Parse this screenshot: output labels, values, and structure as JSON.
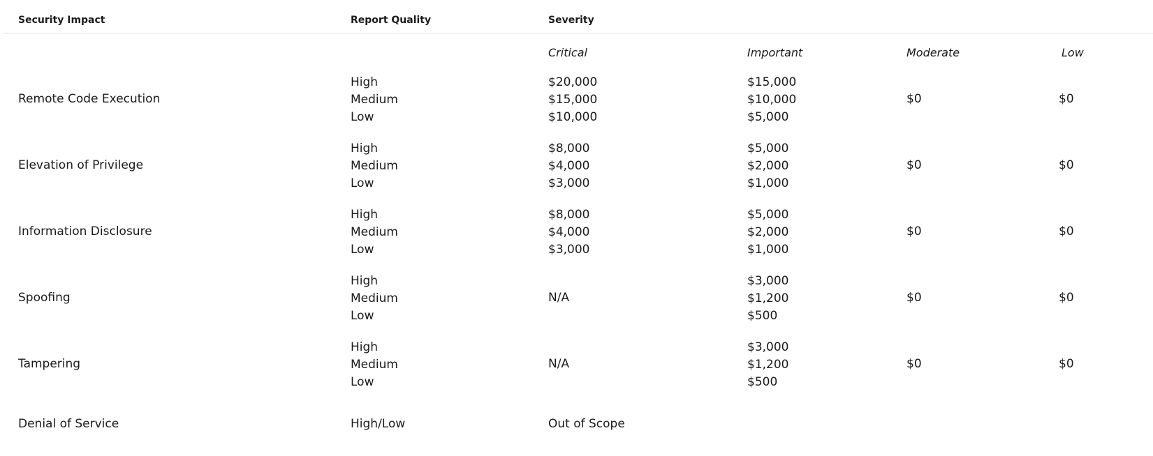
{
  "headers": {
    "security_impact": "Security Impact",
    "report_quality": "Report Quality",
    "severity": "Severity"
  },
  "severity_levels": {
    "critical": "Critical",
    "important": "Important",
    "moderate": "Moderate",
    "low": "Low"
  },
  "rows": [
    {
      "impact": "Remote Code Execution",
      "quality": [
        "High",
        "Medium",
        "Low"
      ],
      "critical": [
        "$20,000",
        "$15,000",
        "$10,000"
      ],
      "important": [
        "$15,000",
        "$10,000",
        "$5,000"
      ],
      "moderate": "$0",
      "low": "$0"
    },
    {
      "impact": "Elevation of Privilege",
      "quality": [
        "High",
        "Medium",
        "Low"
      ],
      "critical": [
        "$8,000",
        "$4,000",
        "$3,000"
      ],
      "important": [
        "$5,000",
        "$2,000",
        "$1,000"
      ],
      "moderate": "$0",
      "low": "$0"
    },
    {
      "impact": "Information Disclosure",
      "quality": [
        "High",
        "Medium",
        "Low"
      ],
      "critical": [
        "$8,000",
        "$4,000",
        "$3,000"
      ],
      "important": [
        "$5,000",
        "$2,000",
        "$1,000"
      ],
      "moderate": "$0",
      "low": "$0"
    },
    {
      "impact": "Spoofing",
      "quality": [
        "High",
        "Medium",
        "Low"
      ],
      "critical": "N/A",
      "important": [
        "$3,000",
        "$1,200",
        "$500"
      ],
      "moderate": "$0",
      "low": "$0"
    },
    {
      "impact": "Tampering",
      "quality": [
        "High",
        "Medium",
        "Low"
      ],
      "critical": "N/A",
      "important": [
        "$3,000",
        "$1,200",
        "$500"
      ],
      "moderate": "$0",
      "low": "$0"
    },
    {
      "impact": "Denial of Service",
      "quality": "High/Low",
      "critical": "Out of Scope"
    }
  ]
}
